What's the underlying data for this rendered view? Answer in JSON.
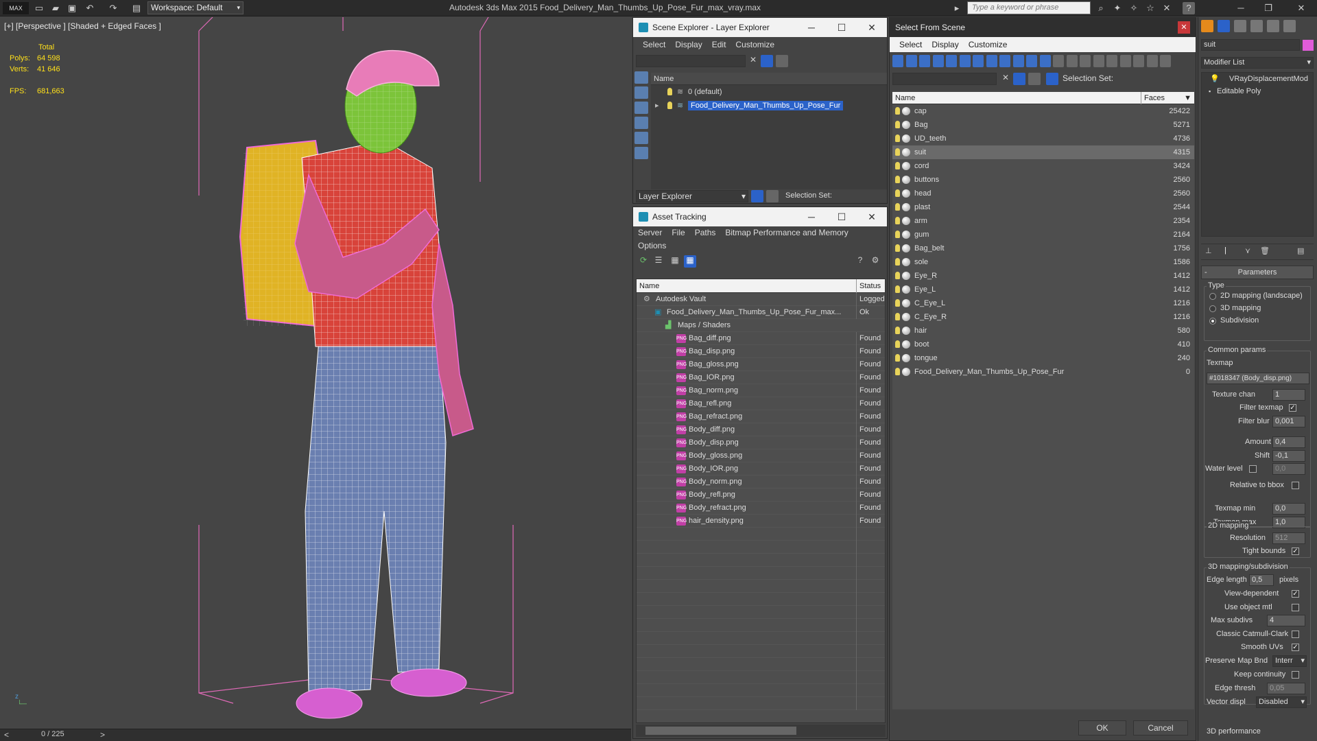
{
  "app": {
    "title": "Autodesk 3ds Max  2015     Food_Delivery_Man_Thumbs_Up_Pose_Fur_max_vray.max",
    "workspace": "Workspace: Default",
    "search_placeholder": "Type a keyword or phrase",
    "logo": "MAX"
  },
  "viewport": {
    "label": "[+] [Perspective ] [Shaded + Edged Faces ]",
    "stats": {
      "total_label": "Total",
      "polys_label": "Polys:",
      "polys": "64 598",
      "verts_label": "Verts:",
      "verts": "41 646",
      "fps_label": "FPS:",
      "fps": "681,663"
    }
  },
  "timeline": {
    "frame": "0 / 225"
  },
  "scene_explorer": {
    "title": "Scene Explorer - Layer Explorer",
    "menu": [
      "Select",
      "Display",
      "Edit",
      "Customize"
    ],
    "col_name": "Name",
    "layers": [
      "0 (default)",
      "Food_Delivery_Man_Thumbs_Up_Pose_Fur"
    ],
    "bottom_dropdown": "Layer Explorer",
    "selection_set_label": "Selection Set:"
  },
  "asset_tracking": {
    "title": "Asset Tracking",
    "menu": [
      "Server",
      "File",
      "Paths",
      "Bitmap Performance and Memory"
    ],
    "menu2": "Options",
    "col_name": "Name",
    "col_status": "Status",
    "rows": [
      {
        "name": "Autodesk Vault",
        "status": "Logged",
        "indent": 0,
        "kind": "vault"
      },
      {
        "name": "Food_Delivery_Man_Thumbs_Up_Pose_Fur_max...",
        "status": "Ok",
        "indent": 1,
        "kind": "max"
      },
      {
        "name": "Maps / Shaders",
        "status": "",
        "indent": 2,
        "kind": "folder"
      },
      {
        "name": "Bag_diff.png",
        "status": "Found",
        "indent": 3,
        "kind": "png"
      },
      {
        "name": "Bag_disp.png",
        "status": "Found",
        "indent": 3,
        "kind": "png"
      },
      {
        "name": "Bag_gloss.png",
        "status": "Found",
        "indent": 3,
        "kind": "png"
      },
      {
        "name": "Bag_IOR.png",
        "status": "Found",
        "indent": 3,
        "kind": "png"
      },
      {
        "name": "Bag_norm.png",
        "status": "Found",
        "indent": 3,
        "kind": "png"
      },
      {
        "name": "Bag_refl.png",
        "status": "Found",
        "indent": 3,
        "kind": "png"
      },
      {
        "name": "Bag_refract.png",
        "status": "Found",
        "indent": 3,
        "kind": "png"
      },
      {
        "name": "Body_diff.png",
        "status": "Found",
        "indent": 3,
        "kind": "png"
      },
      {
        "name": "Body_disp.png",
        "status": "Found",
        "indent": 3,
        "kind": "png"
      },
      {
        "name": "Body_gloss.png",
        "status": "Found",
        "indent": 3,
        "kind": "png"
      },
      {
        "name": "Body_IOR.png",
        "status": "Found",
        "indent": 3,
        "kind": "png"
      },
      {
        "name": "Body_norm.png",
        "status": "Found",
        "indent": 3,
        "kind": "png"
      },
      {
        "name": "Body_refl.png",
        "status": "Found",
        "indent": 3,
        "kind": "png"
      },
      {
        "name": "Body_refract.png",
        "status": "Found",
        "indent": 3,
        "kind": "png"
      },
      {
        "name": "hair_density.png",
        "status": "Found",
        "indent": 3,
        "kind": "png"
      }
    ]
  },
  "select_from_scene": {
    "title": "Select From Scene",
    "menu": [
      "Select",
      "Display",
      "Customize"
    ],
    "selection_set_label": "Selection Set:",
    "col_name": "Name",
    "col_faces": "Faces",
    "objects": [
      {
        "name": "cap",
        "faces": "25422"
      },
      {
        "name": "Bag",
        "faces": "5271"
      },
      {
        "name": "UD_teeth",
        "faces": "4736"
      },
      {
        "name": "suit",
        "faces": "4315",
        "selected": true
      },
      {
        "name": "cord",
        "faces": "3424"
      },
      {
        "name": "buttons",
        "faces": "2560"
      },
      {
        "name": "head",
        "faces": "2560"
      },
      {
        "name": "plast",
        "faces": "2544"
      },
      {
        "name": "arm",
        "faces": "2354"
      },
      {
        "name": "gum",
        "faces": "2164"
      },
      {
        "name": "Bag_belt",
        "faces": "1756"
      },
      {
        "name": "sole",
        "faces": "1586"
      },
      {
        "name": "Eye_R",
        "faces": "1412"
      },
      {
        "name": "Eye_L",
        "faces": "1412"
      },
      {
        "name": "C_Eye_L",
        "faces": "1216"
      },
      {
        "name": "C_Eye_R",
        "faces": "1216"
      },
      {
        "name": "hair",
        "faces": "580"
      },
      {
        "name": "boot",
        "faces": "410"
      },
      {
        "name": "tongue",
        "faces": "240"
      },
      {
        "name": "Food_Delivery_Man_Thumbs_Up_Pose_Fur",
        "faces": "0"
      }
    ],
    "ok": "OK",
    "cancel": "Cancel"
  },
  "modifier": {
    "object_name": "suit",
    "list_label": "Modifier List",
    "stack": [
      "VRayDisplacementMod",
      "Editable Poly"
    ],
    "params_title": "Parameters",
    "type_label": "Type",
    "types": [
      {
        "label": "2D mapping (landscape)",
        "on": false
      },
      {
        "label": "3D mapping",
        "on": false
      },
      {
        "label": "Subdivision",
        "on": true
      }
    ],
    "common_label": "Common params",
    "texmap_label": "Texmap",
    "texmap_value": "#1018347 (Body_disp.png)",
    "texture_chan_label": "Texture chan",
    "texture_chan": "1",
    "filter_texmap_label": "Filter texmap",
    "filter_blur_label": "Filter blur",
    "filter_blur": "0,001",
    "amount_label": "Amount",
    "amount": "0,4",
    "shift_label": "Shift",
    "shift": "-0,1",
    "water_label": "Water level",
    "water": "0,0",
    "relative_label": "Relative to bbox",
    "texmap_min_label": "Texmap min",
    "texmap_min": "0,0",
    "texmap_max_label": "Texmap max",
    "texmap_max": "1,0",
    "mapping2d_label": "2D mapping",
    "resolution_label": "Resolution",
    "resolution": "512",
    "tight_label": "Tight bounds",
    "mapping3d_label": "3D mapping/subdivision",
    "edge_len_label": "Edge length",
    "edge_len": "0,5",
    "pixels_label": "pixels",
    "view_dep_label": "View-dependent",
    "use_obj_label": "Use object mtl",
    "max_subdivs_label": "Max subdivs",
    "max_subdivs": "4",
    "catmull_label": "Classic Catmull-Clark",
    "smooth_uv_label": "Smooth UVs",
    "preserve_label": "Preserve Map Bnd",
    "preserve_value": "Interr",
    "keep_cont_label": "Keep continuity",
    "edge_thresh_label": "Edge thresh",
    "edge_thresh": "0,05",
    "vector_label": "Vector displ",
    "vector_value": "Disabled",
    "perf_label": "3D performance"
  },
  "colors": {
    "selected": "#2b62c9",
    "bulb": "#e8d35a",
    "stats": "#ffe01a",
    "wire_pink": "#f06bd6"
  }
}
